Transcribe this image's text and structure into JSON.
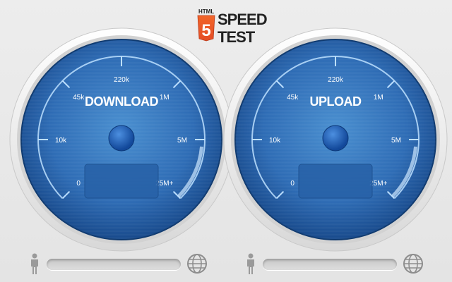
{
  "header": {
    "badge_text": "HTML",
    "badge_number": "5",
    "title_line1": "SPEED",
    "title_line2": "TEST"
  },
  "colors": {
    "dial_center": "#3f83c4",
    "dial_edge": "#1a4f93",
    "accent_red": "#e44d26",
    "needle_knob": "#1f5fb5",
    "tick_line": "#bde0ff"
  },
  "gauges": [
    {
      "label": "DOWNLOAD",
      "ticks": [
        "0",
        "10k",
        "45k",
        "220k",
        "1M",
        "5M",
        "25M+"
      ],
      "readout": "",
      "progress": 0
    },
    {
      "label": "UPLOAD",
      "ticks": [
        "0",
        "10k",
        "45k",
        "220k",
        "1M",
        "5M",
        "25M+"
      ],
      "readout": "",
      "progress": 0
    }
  ],
  "bottom_bars": [
    {
      "left_icon": "person-icon",
      "right_icon": "globe-icon",
      "progress": 0
    },
    {
      "left_icon": "person-icon",
      "right_icon": "globe-icon",
      "progress": 0
    }
  ]
}
